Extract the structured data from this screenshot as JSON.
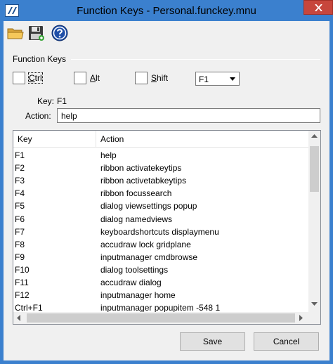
{
  "window": {
    "title": "Function Keys - Personal.funckey.mnu",
    "accent_color": "#3b80ce",
    "close_color": "#c7463c"
  },
  "toolbar": {
    "icons": [
      "open-folder-icon",
      "save-icon",
      "help-icon"
    ]
  },
  "function_keys": {
    "section_label": "Function Keys",
    "ctrl_label": "Ctrl",
    "alt_label": "Alt",
    "shift_label": "Shift",
    "key_select_value": "F1"
  },
  "current": {
    "key_label": "Key:",
    "key_value": "F1",
    "action_label": "Action:",
    "action_value": "help"
  },
  "table": {
    "columns": [
      "Key",
      "Action"
    ],
    "rows": [
      {
        "key": "F1",
        "action": "help"
      },
      {
        "key": "F2",
        "action": "ribbon activatekeytips"
      },
      {
        "key": "F3",
        "action": "ribbon activetabkeytips"
      },
      {
        "key": "F4",
        "action": "ribbon focussearch"
      },
      {
        "key": "F5",
        "action": "dialog viewsettings popup"
      },
      {
        "key": "F6",
        "action": "dialog namedviews"
      },
      {
        "key": "F7",
        "action": "keyboardshortcuts displaymenu"
      },
      {
        "key": "F8",
        "action": "accudraw lock gridplane"
      },
      {
        "key": "F9",
        "action": "inputmanager cmdbrowse"
      },
      {
        "key": "F10",
        "action": "dialog toolsettings"
      },
      {
        "key": "F11",
        "action": "accudraw dialog"
      },
      {
        "key": "F12",
        "action": "inputmanager home"
      },
      {
        "key": "Ctrl+F1",
        "action": "inputmanager popupitem -548 1"
      }
    ]
  },
  "buttons": {
    "save": "Save",
    "cancel": "Cancel"
  }
}
